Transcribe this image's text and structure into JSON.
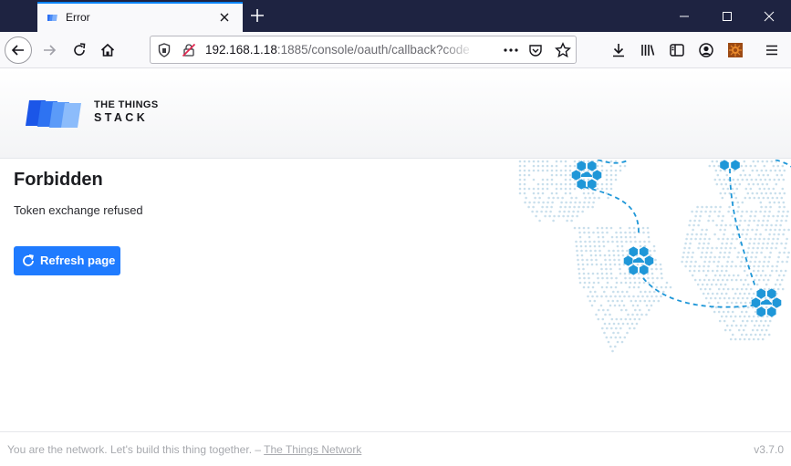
{
  "browser": {
    "tab": {
      "title": "Error"
    },
    "url": {
      "host": "192.168.1.18",
      "rest": ":1885/console/oauth/callback?code"
    }
  },
  "header": {
    "logo": {
      "line1": "THE THINGS",
      "line2": "STACK"
    }
  },
  "main": {
    "title": "Forbidden",
    "message": "Token exchange refused",
    "refresh_label": "Refresh page"
  },
  "footer": {
    "tagline": "You are the network. Let's build this thing together. –",
    "link": "The Things Network",
    "version": "v3.7.0"
  },
  "colors": {
    "accent": "#1f7bff",
    "titlebar": "#1e2341",
    "map_dots": "#c9dfec",
    "node_hex": "#1f97d8"
  },
  "icons": {
    "tab_favicon": "tts-logo-icon",
    "back": "arrow-left-icon",
    "forward": "arrow-right-icon",
    "reload": "reload-icon",
    "home": "home-icon",
    "shield": "tracking-shield-icon",
    "insecure": "insecure-lock-icon",
    "more": "more-dots-icon",
    "pocket": "pocket-icon",
    "bookmark": "star-icon",
    "download": "download-icon",
    "library": "library-icon",
    "sidebar": "sidebar-icon",
    "account": "account-icon",
    "extension": "extension-icon",
    "menu": "hamburger-menu-icon",
    "refresh": "refresh-icon"
  }
}
